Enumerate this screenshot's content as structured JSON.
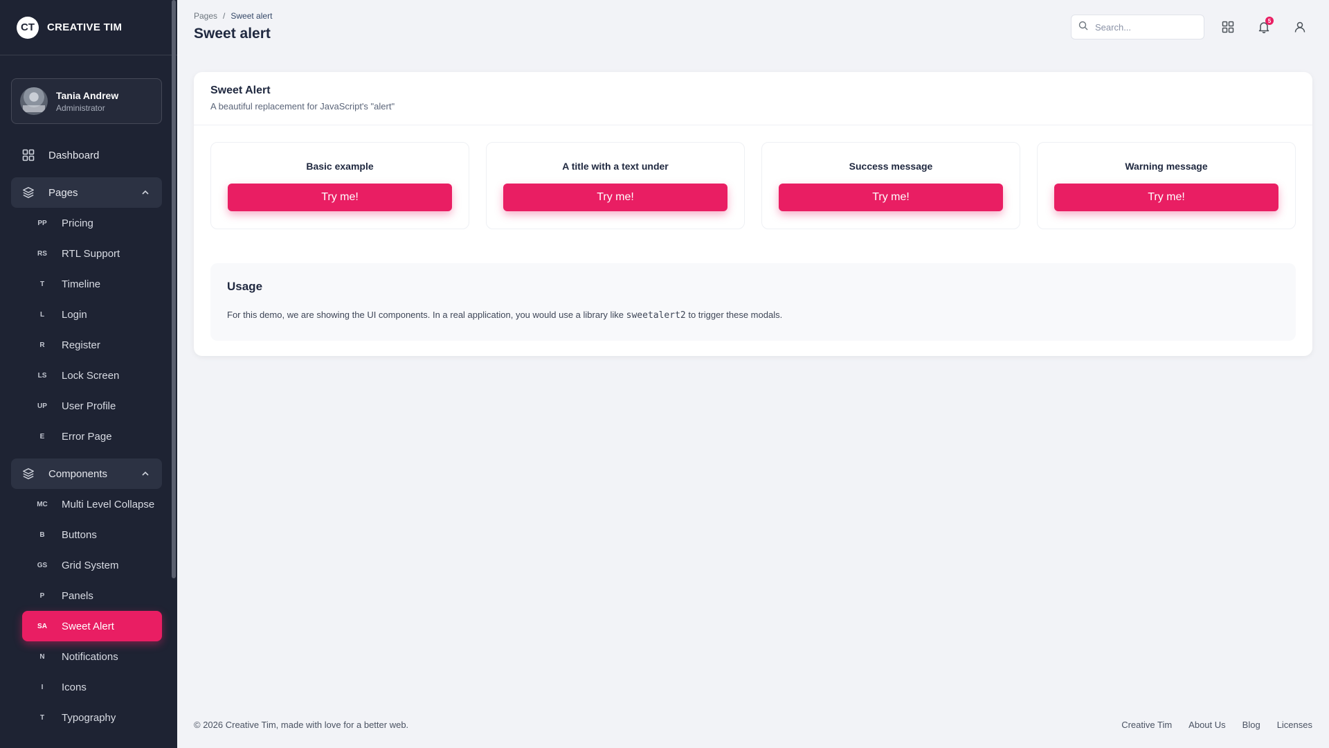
{
  "brand": {
    "logo": "CT",
    "name": "CREATIVE TIM"
  },
  "user": {
    "name": "Tania Andrew",
    "role": "Administrator"
  },
  "nav": {
    "dashboard": "Dashboard",
    "pages": {
      "label": "Pages",
      "items": [
        {
          "abbr": "PP",
          "label": "Pricing"
        },
        {
          "abbr": "RS",
          "label": "RTL Support"
        },
        {
          "abbr": "T",
          "label": "Timeline"
        },
        {
          "abbr": "L",
          "label": "Login"
        },
        {
          "abbr": "R",
          "label": "Register"
        },
        {
          "abbr": "LS",
          "label": "Lock Screen"
        },
        {
          "abbr": "UP",
          "label": "User Profile"
        },
        {
          "abbr": "E",
          "label": "Error Page"
        }
      ]
    },
    "components": {
      "label": "Components",
      "items": [
        {
          "abbr": "MC",
          "label": "Multi Level Collapse"
        },
        {
          "abbr": "B",
          "label": "Buttons"
        },
        {
          "abbr": "GS",
          "label": "Grid System"
        },
        {
          "abbr": "P",
          "label": "Panels"
        },
        {
          "abbr": "SA",
          "label": "Sweet Alert"
        },
        {
          "abbr": "N",
          "label": "Notifications"
        },
        {
          "abbr": "I",
          "label": "Icons"
        },
        {
          "abbr": "T",
          "label": "Typography"
        }
      ]
    }
  },
  "header": {
    "breadcrumb_parent": "Pages",
    "breadcrumb_sep": "/",
    "breadcrumb_current": "Sweet alert",
    "title": "Sweet alert",
    "search_placeholder": "Search...",
    "notification_count": "5"
  },
  "card": {
    "title": "Sweet Alert",
    "subtitle": "A beautiful replacement for JavaScript's \"alert\"",
    "examples": [
      {
        "title": "Basic example",
        "button": "Try me!"
      },
      {
        "title": "A title with a text under",
        "button": "Try me!"
      },
      {
        "title": "Success message",
        "button": "Try me!"
      },
      {
        "title": "Warning message",
        "button": "Try me!"
      }
    ],
    "usage": {
      "title": "Usage",
      "text_before": "For this demo, we are showing the UI components. In a real application, you would use a library like ",
      "code": "sweetalert2",
      "text_after": " to trigger these modals."
    }
  },
  "footer": {
    "copyright": "© 2026 Creative Tim, made with love for a better web.",
    "links": [
      "Creative Tim",
      "About Us",
      "Blog",
      "Licenses"
    ]
  },
  "colors": {
    "accent": "#e91e63",
    "sidebar": "#1e2333",
    "background": "#f2f3f7"
  }
}
